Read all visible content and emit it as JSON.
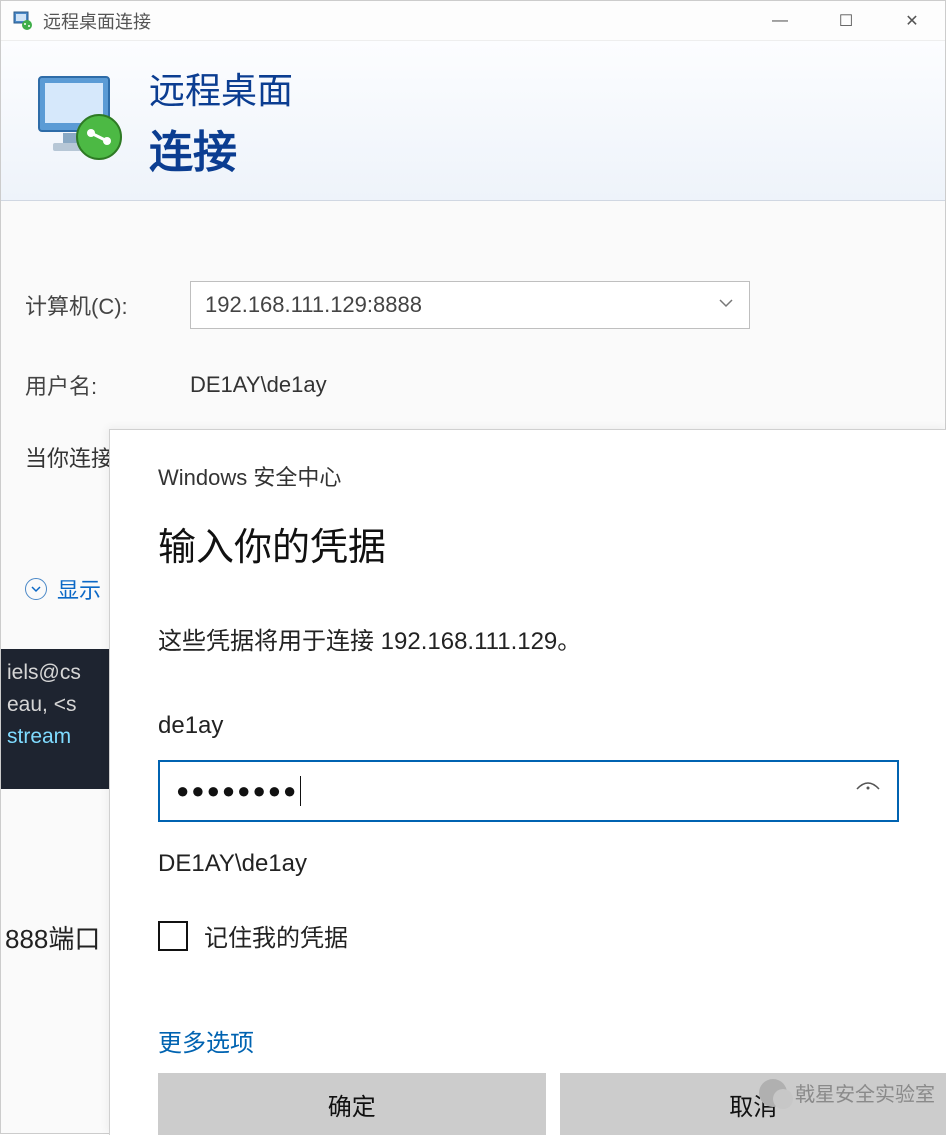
{
  "window": {
    "title": "远程桌面连接",
    "minimize": "—",
    "maximize": "☐",
    "close": "✕"
  },
  "banner": {
    "line1": "远程桌面",
    "line2": "连接"
  },
  "form": {
    "computer_label": "计算机(C):",
    "computer_value": "192.168.111.129:8888",
    "username_label": "用户名:",
    "username_value": "DE1AY\\de1ay",
    "connect_note": "当你连接",
    "show_options": "显示"
  },
  "terminal": {
    "line1": "iels@cs",
    "line2": "eau, <s",
    "line3": " stream"
  },
  "port_note": "888端口",
  "credential": {
    "subtitle": "Windows 安全中心",
    "title": "输入你的凭据",
    "desc": "这些凭据将用于连接 192.168.111.129。",
    "user": "de1ay",
    "password_masked": "●●●●●●●●",
    "domain_user": "DE1AY\\de1ay",
    "remember": "记住我的凭据",
    "more_options": "更多选项",
    "ok": "确定",
    "cancel": "取消"
  },
  "watermark": "戟星安全实验室"
}
